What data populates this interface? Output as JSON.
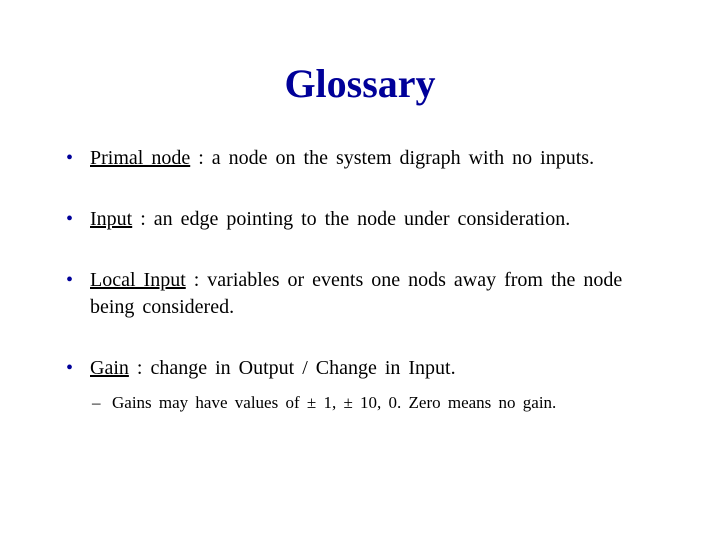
{
  "title": "Glossary",
  "items": [
    {
      "term": "Primal  node",
      "def": " : a  node  on  the  system  digraph  with  no inputs."
    },
    {
      "term": "Input",
      "def": " : an  edge  pointing  to  the  node  under consideration."
    },
    {
      "term": "Local  Input",
      "def": " : variables  or  events  one  nods  away  from the  node  being  considered."
    },
    {
      "term": "Gain",
      "def": " : change  in  Output / Change  in  Input.",
      "sub": [
        "Gains  may  have  values  of  ± 1, ± 10, 0.  Zero  means  no  gain."
      ]
    }
  ]
}
